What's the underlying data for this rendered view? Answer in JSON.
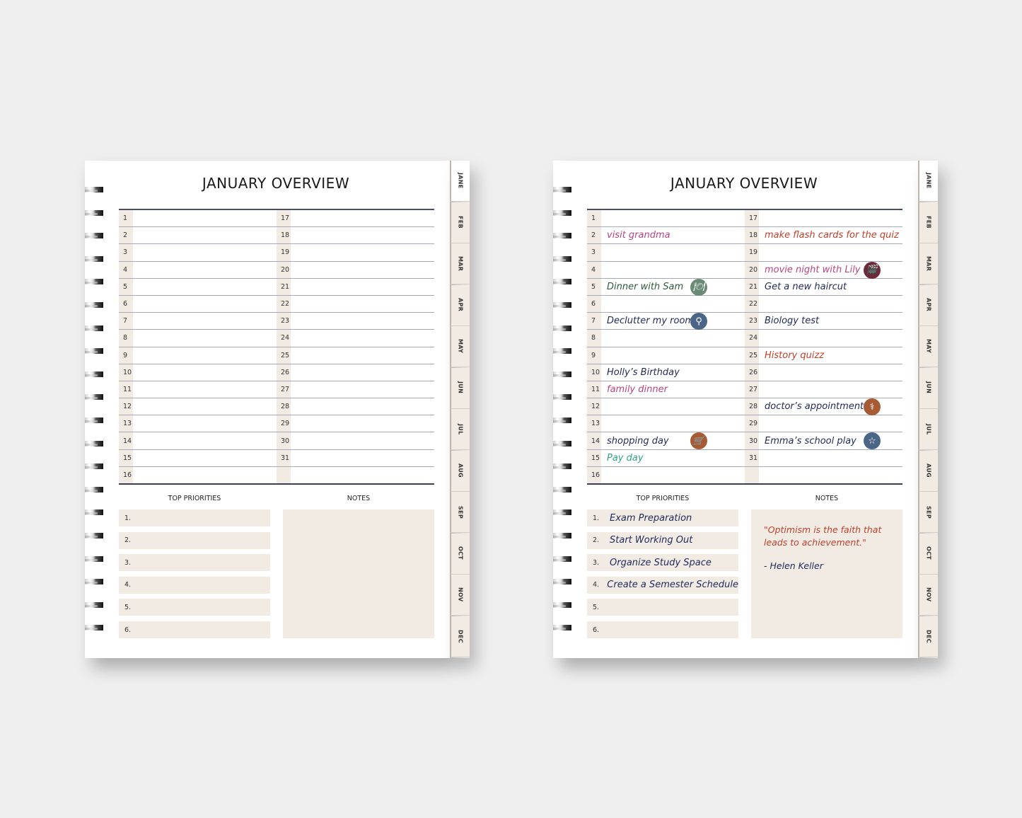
{
  "tabs": [
    "JANE",
    "FEB",
    "MAR",
    "APR",
    "MAY",
    "JUN",
    "JUL",
    "AUG",
    "SEP",
    "OCT",
    "NOV",
    "DEC"
  ],
  "colors": {
    "navy": "#1f2a5a",
    "pink": "#b6457f",
    "red": "#c0402a",
    "green": "#2e5a3a",
    "teal": "#2fa57a",
    "beige": "#f2ebe4",
    "icon_green": "#6b8a76",
    "icon_blue": "#4a6585",
    "icon_wine": "#6e2a3a",
    "icon_brown": "#a65b32"
  },
  "left_planner": {
    "title": "JANUARY OVERVIEW",
    "days_left": [
      "1",
      "2",
      "3",
      "4",
      "5",
      "6",
      "7",
      "8",
      "9",
      "10",
      "11",
      "12",
      "13",
      "14",
      "15",
      "16"
    ],
    "days_right": [
      "17",
      "18",
      "19",
      "20",
      "21",
      "22",
      "23",
      "24",
      "25",
      "26",
      "27",
      "28",
      "29",
      "30",
      "31",
      ""
    ],
    "priorities_label": "TOP PRIORITIES",
    "notes_label": "NOTES",
    "priorities": [
      {
        "num": "1.",
        "text": ""
      },
      {
        "num": "2.",
        "text": ""
      },
      {
        "num": "3.",
        "text": ""
      },
      {
        "num": "4.",
        "text": ""
      },
      {
        "num": "5.",
        "text": ""
      },
      {
        "num": "6.",
        "text": ""
      }
    ]
  },
  "right_planner": {
    "title": "JANUARY OVERVIEW",
    "entries": {
      "2": {
        "text": "visit grandma",
        "color": "pink"
      },
      "5": {
        "text": "Dinner with Sam",
        "color": "green",
        "icon": "dinner-plate-icon",
        "icon_color": "icon_green",
        "glyph": "🍽"
      },
      "7": {
        "text": "Declutter my room",
        "color": "navy",
        "icon": "broom-icon",
        "icon_color": "icon_blue",
        "glyph": "⚲"
      },
      "10": {
        "text": "Holly’s Birthday",
        "color": "navy"
      },
      "11": {
        "text": "family dinner",
        "color": "pink"
      },
      "14": {
        "text": "shopping day",
        "color": "navy",
        "icon": "shopping-cart-icon",
        "icon_color": "icon_brown",
        "glyph": "🛒"
      },
      "15": {
        "text": "Pay day",
        "color": "teal"
      },
      "18": {
        "text": "make flash cards for the quiz",
        "color": "red"
      },
      "20": {
        "text": "movie night with Lily",
        "color": "pink",
        "icon": "clapperboard-icon",
        "icon_color": "icon_wine",
        "glyph": "🎬"
      },
      "21": {
        "text": "Get a new haircut",
        "color": "navy"
      },
      "23": {
        "text": "Biology test",
        "color": "navy"
      },
      "25": {
        "text": "History quizz",
        "color": "red"
      },
      "28": {
        "text": "doctor’s appointment",
        "color": "navy",
        "icon": "stethoscope-icon",
        "icon_color": "icon_brown",
        "glyph": "⚕"
      },
      "30": {
        "text": "Emma’s school play",
        "color": "navy",
        "icon": "star-icon",
        "icon_color": "icon_blue",
        "glyph": "☆"
      }
    },
    "priorities_label": "TOP PRIORITIES",
    "notes_label": "NOTES",
    "priorities": [
      {
        "num": "1.",
        "text": "Exam Preparation"
      },
      {
        "num": "2.",
        "text": "Start Working Out"
      },
      {
        "num": "3.",
        "text": "Organize Study Space"
      },
      {
        "num": "4.",
        "text": "Create a Semester Schedule"
      },
      {
        "num": "5.",
        "text": ""
      },
      {
        "num": "6.",
        "text": ""
      }
    ],
    "notes": {
      "quote": "\"Optimism is the faith that leads to achievement.\"",
      "author": "- Helen Keller"
    }
  }
}
